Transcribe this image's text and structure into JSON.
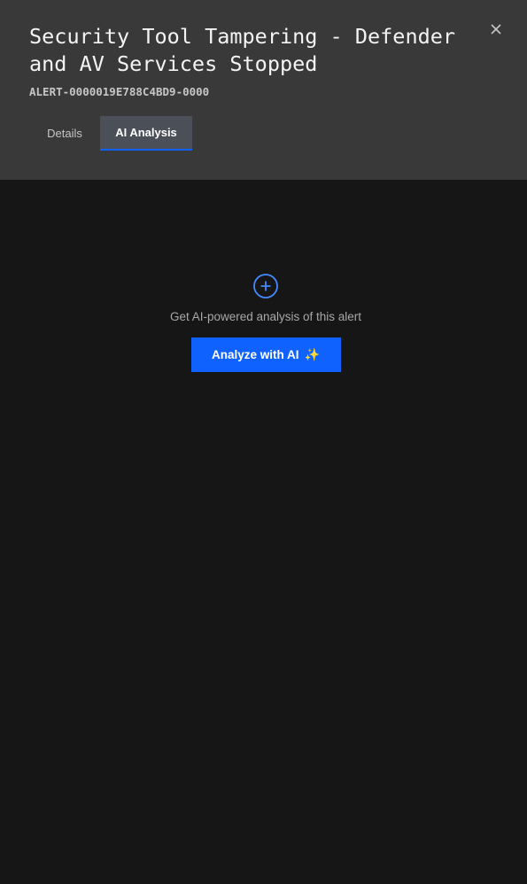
{
  "alert": {
    "title": "Security Tool Tampering - Defender and AV Services Stopped",
    "id": "ALERT-0000019E788C4BD9-0000"
  },
  "close_icon": "close-icon",
  "tabs": [
    {
      "label": "Details",
      "active": false
    },
    {
      "label": "AI Analysis",
      "active": true
    }
  ],
  "ai_analysis": {
    "icon": "plus-circle-icon",
    "prompt_text": "Get AI-powered analysis of this alert",
    "button_label": "Analyze with AI",
    "button_icon": "sparkle-icon",
    "button_icon_glyph": "✨"
  },
  "colors": {
    "header_bg": "#393939",
    "content_bg": "#161616",
    "accent": "#0f62fe"
  }
}
